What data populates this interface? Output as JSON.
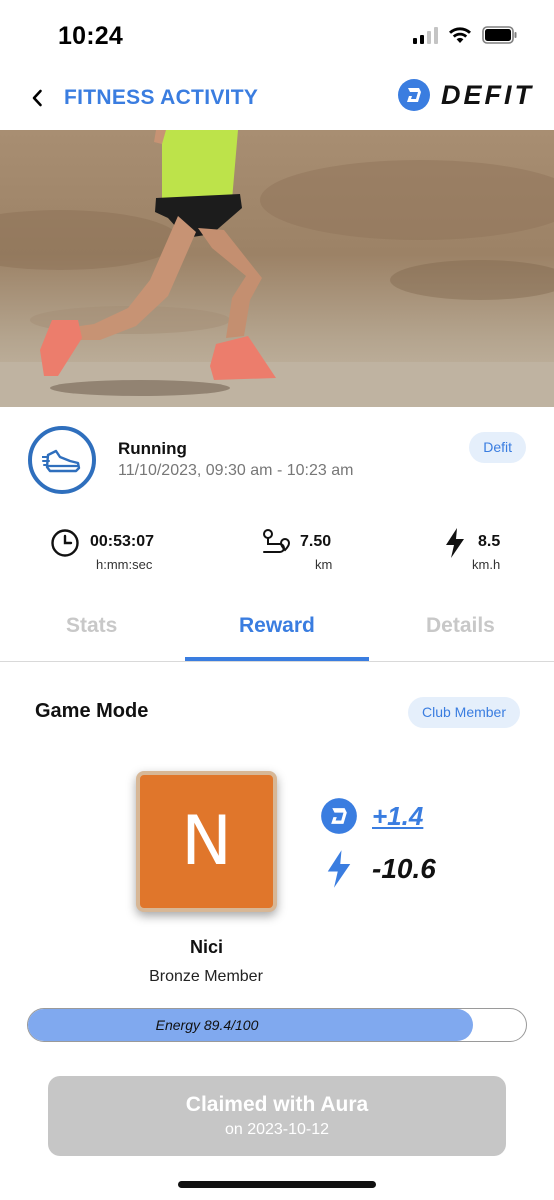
{
  "status_bar": {
    "time": "10:24"
  },
  "header": {
    "title": "FITNESS ACTIVITY",
    "brand": "DEFIT"
  },
  "activity": {
    "type": "Running",
    "time_range": "11/10/2023, 09:30 am - 10:23 am",
    "source_badge": "Defit"
  },
  "metrics": [
    {
      "icon": "clock-icon",
      "value": "00:53:07",
      "unit": "h:mm:sec"
    },
    {
      "icon": "route-icon",
      "value": "7.50",
      "unit": "km"
    },
    {
      "icon": "lightning-icon",
      "value": "8.5",
      "unit": "km.h"
    }
  ],
  "tabs": [
    {
      "label": "Stats",
      "active": false
    },
    {
      "label": "Reward",
      "active": true
    },
    {
      "label": "Details",
      "active": false
    }
  ],
  "game_mode": {
    "title": "Game Mode",
    "badge": "Club Member",
    "avatar_letter": "N",
    "user_name": "Nici",
    "user_tier": "Bronze Member",
    "coin_reward": "+1.4",
    "energy_change": "-10.6",
    "energy_label": "Energy 89.4/100",
    "energy_fraction": 0.894
  },
  "claim": {
    "title": "Claimed with Aura",
    "date": "on 2023-10-12"
  },
  "colors": {
    "accent": "#3a7de0",
    "avatar": "#e0762b",
    "energy_fill": "#80a9ef"
  }
}
